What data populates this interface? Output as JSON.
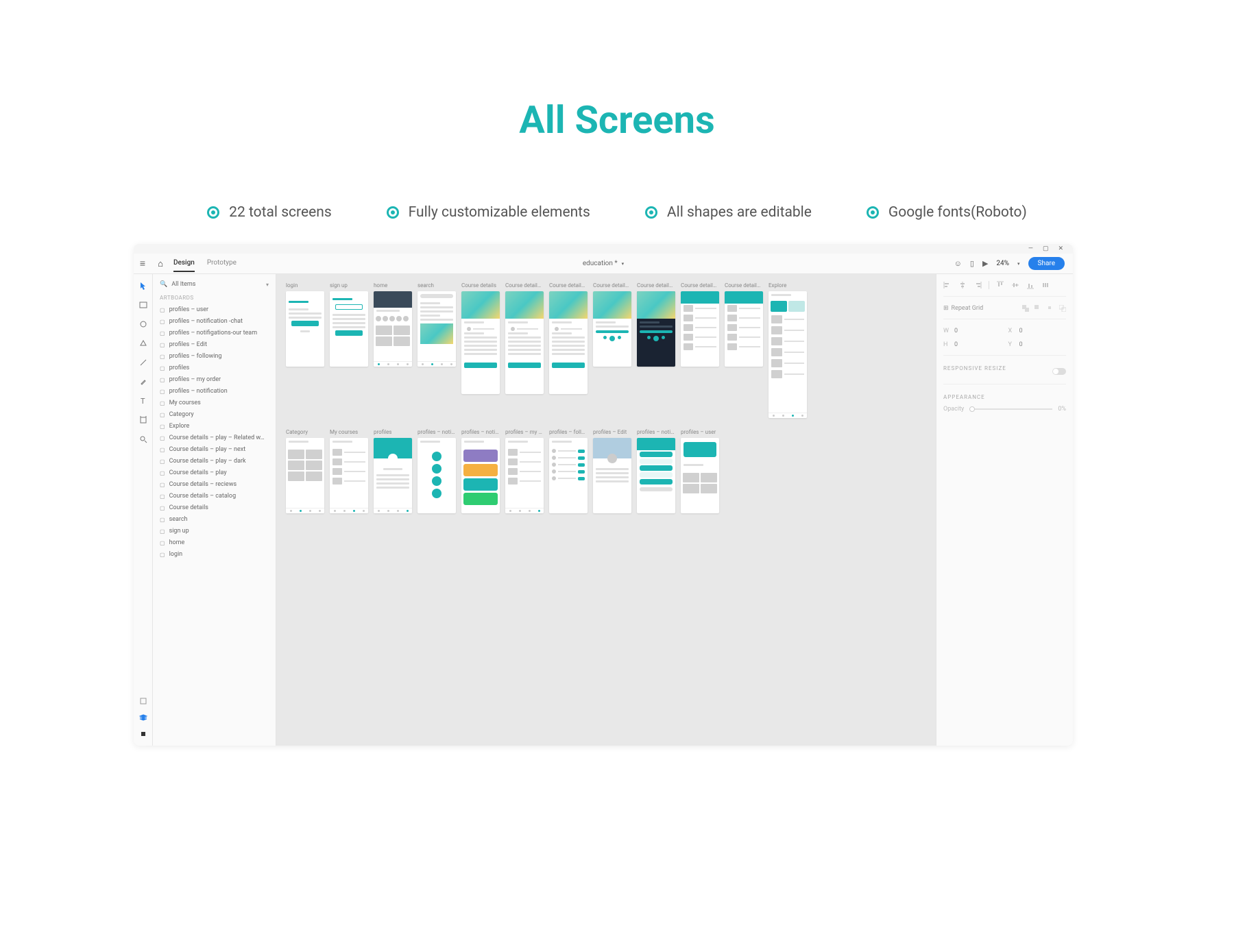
{
  "page_title": "All Screens",
  "features": [
    "22 total screens",
    "Fully customizable elements",
    "All shapes are editable",
    "Google fonts(Roboto)"
  ],
  "top_bar": {
    "tabs": [
      "Design",
      "Prototype"
    ],
    "active_tab": 0,
    "doc_title": "education *",
    "zoom": "24%",
    "share_label": "Share"
  },
  "layers": {
    "search_placeholder": "All Items",
    "section_label": "ARTBOARDS",
    "items": [
      "profiles – user",
      "profiles – notification -chat",
      "profiles – notifigations-our team",
      "profiles – Edit",
      "profiles – following",
      "profiles",
      "profiles – my order",
      "profiles – notification",
      "My courses",
      "Category",
      "Explore",
      "Course details – play – Related w…",
      "Course details – play – next",
      "Course details – play – dark",
      "Course details – play",
      "Course details – reciews",
      "Course details – catalog",
      "Course details",
      "search",
      "sign up",
      "home",
      "login"
    ]
  },
  "artboards_row1": [
    {
      "label": "login",
      "type": "login"
    },
    {
      "label": "sign up",
      "type": "signup"
    },
    {
      "label": "home",
      "type": "home"
    },
    {
      "label": "search",
      "type": "search"
    },
    {
      "label": "Course details",
      "type": "course"
    },
    {
      "label": "Course details – …",
      "type": "course"
    },
    {
      "label": "Course details – …",
      "type": "course"
    },
    {
      "label": "Course details – …",
      "type": "course-play"
    },
    {
      "label": "Course details – …",
      "type": "course-dark"
    },
    {
      "label": "Course details – …",
      "type": "course-list"
    },
    {
      "label": "Course details – …",
      "type": "course-list"
    },
    {
      "label": "Explore",
      "type": "explore"
    }
  ],
  "artboards_row2": [
    {
      "label": "Category",
      "type": "category"
    },
    {
      "label": "My courses",
      "type": "mycourses"
    },
    {
      "label": "profiles",
      "type": "profiles"
    },
    {
      "label": "profiles – notifi…",
      "type": "notif"
    },
    {
      "label": "profiles – notigi…",
      "type": "notif2"
    },
    {
      "label": "profiles – my ord…",
      "type": "order"
    },
    {
      "label": "profiles – followi…",
      "type": "following"
    },
    {
      "label": "profiles – Edit",
      "type": "edit"
    },
    {
      "label": "profiles – notific…",
      "type": "chat"
    },
    {
      "label": "profiles – user",
      "type": "user"
    }
  ],
  "right_panel": {
    "repeat_label": "Repeat Grid",
    "transform": {
      "w": "0",
      "x": "0",
      "h": "0",
      "y": "0"
    },
    "resize_label": "RESPONSIVE RESIZE",
    "appearance_label": "APPEARANCE",
    "opacity_label": "Opacity",
    "opacity_value": "0%"
  }
}
